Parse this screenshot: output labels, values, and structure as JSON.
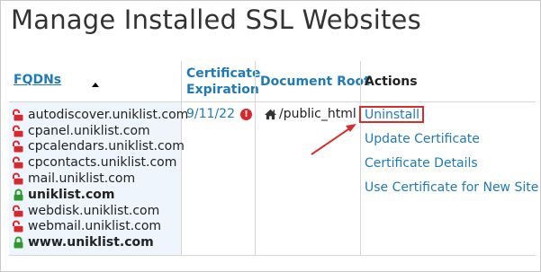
{
  "page": {
    "title": "Manage Installed SSL Websites"
  },
  "table": {
    "headers": {
      "fqdns": "FQDNs",
      "expiration_line1": "Certificate",
      "expiration_line2": "Expiration",
      "document_root": "Document Root",
      "actions": "Actions"
    },
    "fqdns": [
      {
        "name": "autodiscover.uniklist.com",
        "lock": "unlocked",
        "bold": false
      },
      {
        "name": "cpanel.uniklist.com",
        "lock": "unlocked",
        "bold": false
      },
      {
        "name": "cpcalendars.uniklist.com",
        "lock": "unlocked",
        "bold": false
      },
      {
        "name": "cpcontacts.uniklist.com",
        "lock": "unlocked",
        "bold": false
      },
      {
        "name": "mail.uniklist.com",
        "lock": "unlocked",
        "bold": false
      },
      {
        "name": "uniklist.com",
        "lock": "locked",
        "bold": true
      },
      {
        "name": "webdisk.uniklist.com",
        "lock": "unlocked",
        "bold": false
      },
      {
        "name": "webmail.uniklist.com",
        "lock": "unlocked",
        "bold": false
      },
      {
        "name": "www.uniklist.com",
        "lock": "locked",
        "bold": true
      }
    ],
    "expiration": "9/11/22",
    "document_root": "/public_html",
    "actions": {
      "uninstall": "Uninstall",
      "update": "Update Certificate",
      "details": "Certificate Details",
      "use_new": "Use Certificate for New Site"
    }
  },
  "icons": {
    "unlocked": "unlock-icon",
    "locked": "lock-icon",
    "warning": "exclamation-circle-icon",
    "home": "home-icon",
    "sort": "sort-up-icon"
  },
  "colors": {
    "link": "#1f7bb8",
    "lock_open": "#d6282d",
    "lock_closed": "#2e9a2e",
    "highlight": "#d32f2f",
    "fqdn_column_bg": "#eef5fc"
  }
}
